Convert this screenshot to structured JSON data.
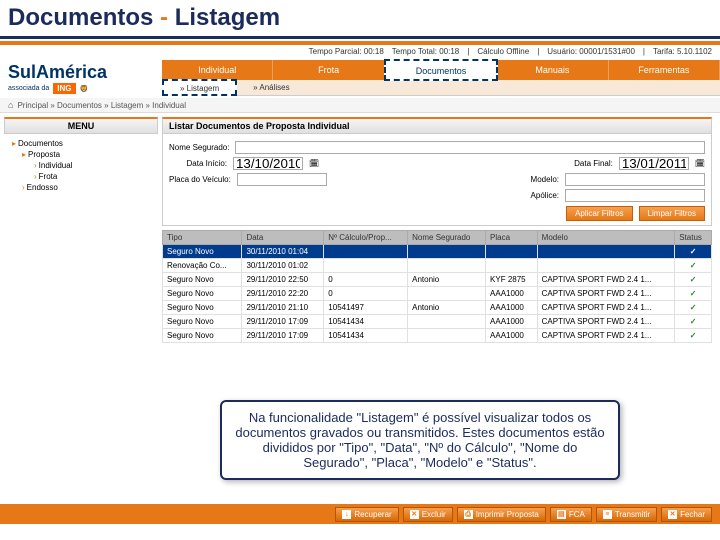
{
  "slide": {
    "title_a": "Documentos",
    "title_sep": " - ",
    "title_b": "Listagem"
  },
  "topbar": {
    "tempo_parcial": "Tempo Parcial: 00:18",
    "tempo_total": "Tempo Total: 00:18",
    "status": "Cálculo Offline",
    "usuario": "Usuário: 00001/1531#00",
    "tarifa": "Tarifa: 5.10.1102"
  },
  "logo": {
    "brand": "SulAmérica",
    "assoc": "associada da",
    "ing": "ING"
  },
  "tabs": [
    "Individual",
    "Frota",
    "Documentos",
    "Manuais",
    "Ferramentas"
  ],
  "subtabs": [
    "» Listagem",
    "» Análises"
  ],
  "breadcrumb": "Principal » Documentos » Listagem » Individual",
  "menu": {
    "header": "MENU",
    "items": {
      "documentos": "Documentos",
      "proposta": "Proposta",
      "individual": "Individual",
      "frota": "Frota",
      "endosso": "Endosso"
    }
  },
  "panel": {
    "title": "Listar Documentos de Proposta Individual"
  },
  "filters": {
    "nome_label": "Nome Segurado:",
    "data_inicio_label": "Data Início:",
    "data_inicio": "13/10/2010",
    "data_final_label": "Data Final:",
    "data_final": "13/01/2011",
    "placa_label": "Placa do Veículo:",
    "modelo_label": "Modelo:",
    "apolice_label": "Apólice:",
    "aplicar": "Aplicar Filtros",
    "limpar": "Limpar Filtros"
  },
  "table": {
    "headers": [
      "Tipo",
      "Data",
      "Nº Cálculo/Prop...",
      "Nome Segurado",
      "Placa",
      "Modelo",
      "Status"
    ],
    "rows": [
      [
        "Seguro Novo",
        "30/11/2010 01:04",
        "",
        "",
        "",
        "",
        "✓"
      ],
      [
        "Renovação Co...",
        "30/11/2010 01:02",
        "",
        "",
        "",
        "",
        "✓"
      ],
      [
        "Seguro Novo",
        "29/11/2010 22:50",
        "0",
        "Antonio",
        "KYF 2875",
        "CAPTIVA SPORT FWD 2.4 1...",
        "✓"
      ],
      [
        "Seguro Novo",
        "29/11/2010 22:20",
        "0",
        "",
        "AAA1000",
        "CAPTIVA SPORT FWD 2.4 1...",
        "✓"
      ],
      [
        "Seguro Novo",
        "29/11/2010 21:10",
        "10541497",
        "Antonio",
        "AAA1000",
        "CAPTIVA SPORT FWD 2.4 1...",
        "✓"
      ],
      [
        "Seguro Novo",
        "29/11/2010 17:09",
        "10541434",
        "",
        "AAA1000",
        "CAPTIVA SPORT FWD 2.4 1...",
        "✓"
      ],
      [
        "Seguro Novo",
        "29/11/2010 17:09",
        "10541434",
        "",
        "AAA1000",
        "CAPTIVA SPORT FWD 2.4 1...",
        "✓"
      ]
    ]
  },
  "callout": "Na funcionalidade \"Listagem\" é possível visualizar todos os documentos gravados ou transmitidos. Estes documentos estão divididos por \"Tipo\", \"Data\", \"Nº do Cálculo\", \"Nome do Segurado\", \"Placa\", \"Modelo\" e \"Status\".",
  "footer": {
    "recuperar": "Recuperar",
    "excluir": "Excluir",
    "imprimir": "Imprimir Proposta",
    "fca": "FCA",
    "transmitir": "Transmitir",
    "fechar": "Fechar"
  }
}
